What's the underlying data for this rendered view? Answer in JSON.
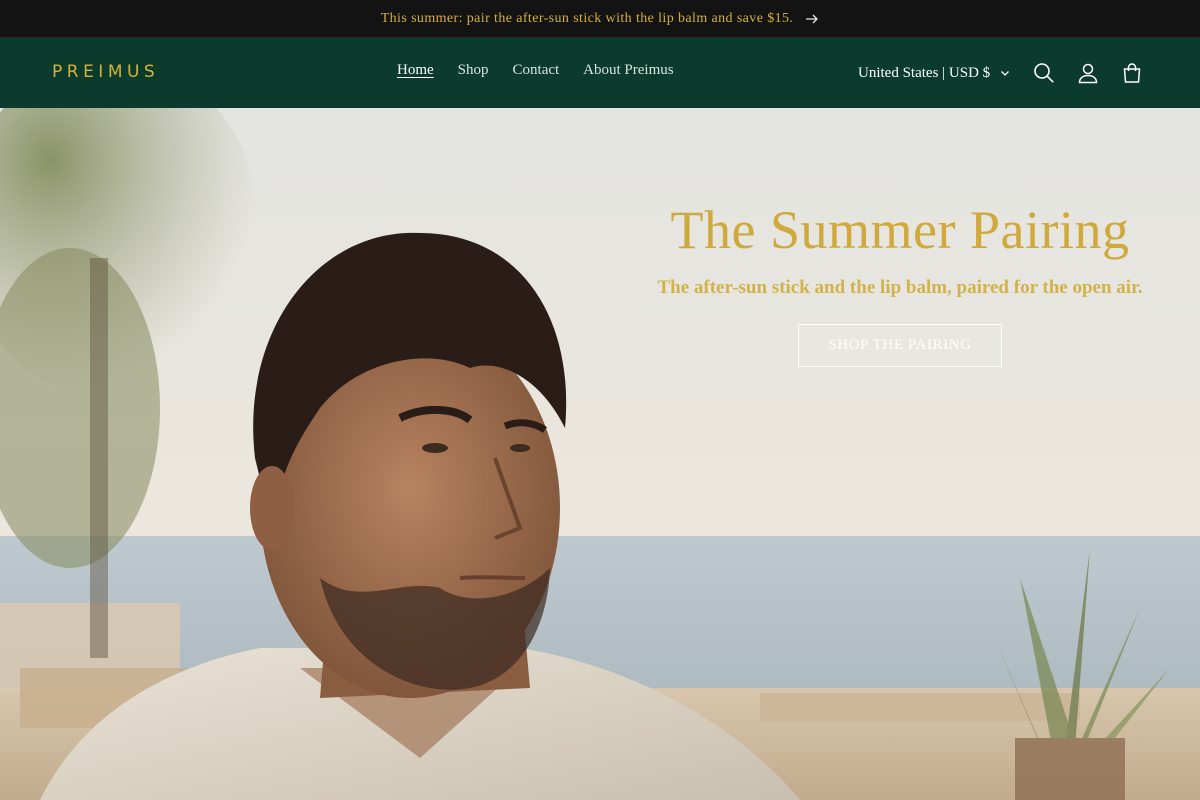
{
  "announcement": {
    "text": "This summer: pair the after-sun stick with the lip balm and save $15.",
    "arrow_icon": "arrow-right-icon"
  },
  "header": {
    "logo": "PREIMUS",
    "nav": [
      {
        "label": "Home",
        "active": true
      },
      {
        "label": "Shop",
        "active": false
      },
      {
        "label": "Contact",
        "active": false
      },
      {
        "label": "About Preimus",
        "active": false
      }
    ],
    "currency": "United States | USD $",
    "icons": [
      "search-icon",
      "account-icon",
      "cart-icon"
    ]
  },
  "hero": {
    "title": "The Summer Pairing",
    "subtitle": "The after-sun stick and the lip balm, paired for the open air.",
    "button": "SHOP THE PAIRING"
  },
  "colors": {
    "announcement_bg": "#131313",
    "header_bg": "#0b3b2c",
    "gold": "#d4b03a"
  }
}
